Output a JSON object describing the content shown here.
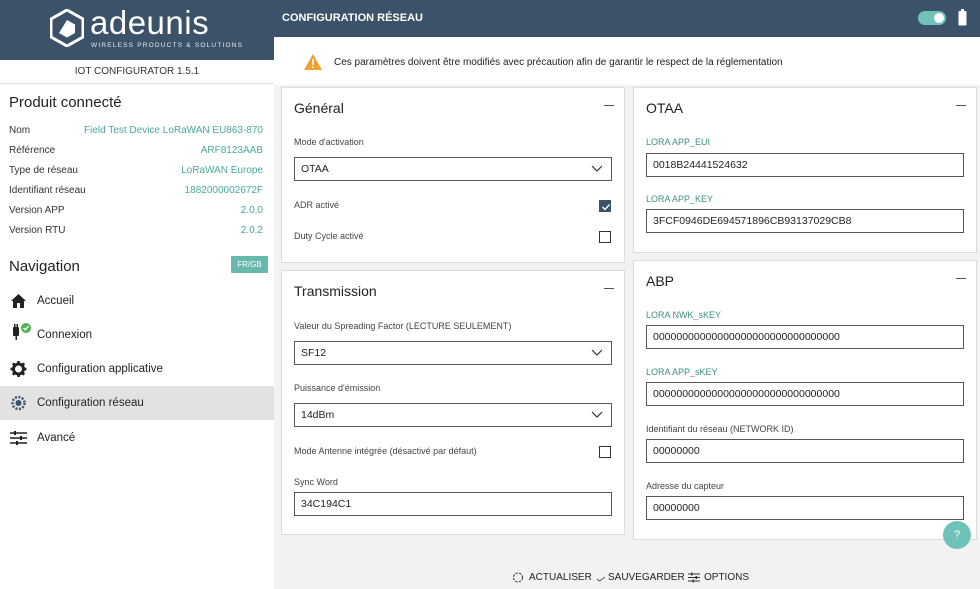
{
  "brand": {
    "name": "adeunis",
    "tagline": "WIRELESS PRODUCTS & SOLUTIONS"
  },
  "app": {
    "version": "IOT CONFIGURATOR 1.5.1"
  },
  "product": {
    "title": "Produit connecté",
    "rows": [
      {
        "key": "Nom",
        "value": "Field Test Device LoRaWAN EU863-870"
      },
      {
        "key": "Référence",
        "value": "ARF8123AAB"
      },
      {
        "key": "Type de réseau",
        "value": "LoRaWAN Europe"
      },
      {
        "key": "Identifiant réseau",
        "value": "1882000002672F"
      },
      {
        "key": "Version APP",
        "value": "2.0.0"
      },
      {
        "key": "Version RTU",
        "value": "2.0.2"
      }
    ]
  },
  "navigation": {
    "title": "Navigation",
    "lang": "FR/GB",
    "items": [
      {
        "label": "Accueil",
        "icon": "home-icon"
      },
      {
        "label": "Connexion",
        "icon": "plug-icon"
      },
      {
        "label": "Configuration applicative",
        "icon": "gear-icon"
      },
      {
        "label": "Configuration réseau",
        "icon": "network-gear-icon",
        "active": true
      },
      {
        "label": "Avancé",
        "icon": "sliders-icon"
      }
    ]
  },
  "header": {
    "title": "CONFIGURATION RÉSEAU",
    "toggle_on": true
  },
  "warning": {
    "text": "Ces paramètres doivent être modifiés avec précaution afin de garantir le respect de la réglementation"
  },
  "general": {
    "title": "Général",
    "activation_label": "Mode d'activation",
    "activation_value": "OTAA",
    "adr_label": "ADR activé",
    "adr_checked": true,
    "duty_label": "Duty Cycle activé",
    "duty_checked": false
  },
  "transmission": {
    "title": "Transmission",
    "sf_label": "Valeur du Spreading Factor (LECTURE SEULEMENT)",
    "sf_value": "SF12",
    "power_label": "Puissance d'émission",
    "power_value": "14dBm",
    "antenna_label": "Mode Antenne intégrée (désactivé par défaut)",
    "antenna_checked": false,
    "sync_label": "Sync Word",
    "sync_value": "34C194C1"
  },
  "otaa": {
    "title": "OTAA",
    "eui_label": "LORA APP_EUI",
    "eui_value": "0018B24441524632",
    "key_label": "LORA APP_KEY",
    "key_value": "3FCF0946DE694571896CB93137029CB8"
  },
  "abp": {
    "title": "ABP",
    "nwk_label": "LORA NWK_sKEY",
    "nwk_value": "00000000000000000000000000000000",
    "app_label": "LORA APP_sKEY",
    "app_value": "00000000000000000000000000000000",
    "netid_label": "Identifiant du réseau (NETWORK ID)",
    "netid_value": "00000000",
    "addr_label": "Adresse du capteur",
    "addr_value": "00000000"
  },
  "actions": {
    "refresh": "ACTUALISER",
    "save": "SAUVEGARDER",
    "options": "OPTIONS"
  },
  "help": "?",
  "colors": {
    "header": "#3b5269",
    "accent": "#4aa9a0",
    "toggle": "#6fc2b8"
  }
}
